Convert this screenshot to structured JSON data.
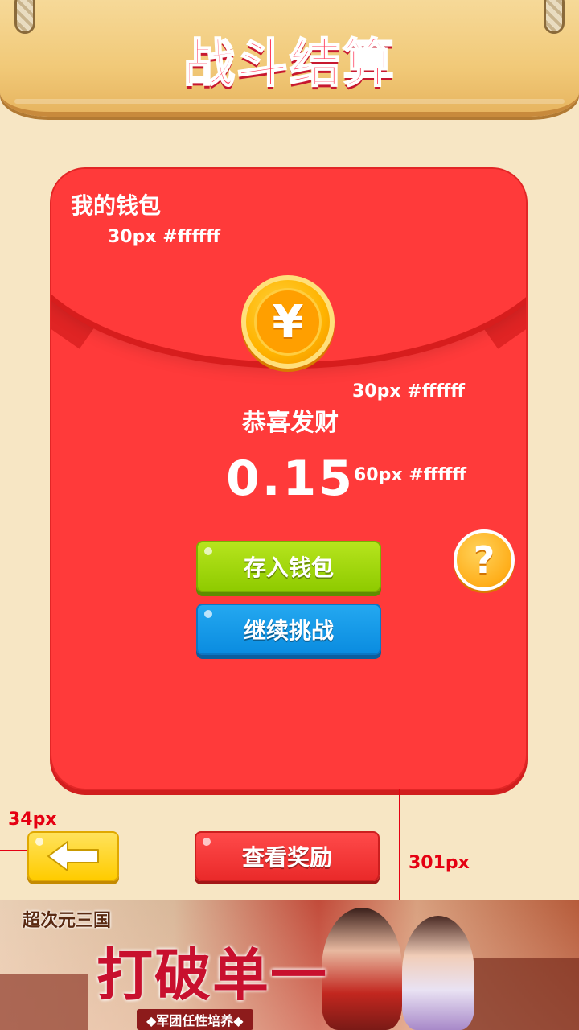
{
  "header": {
    "title": "战斗结算"
  },
  "wallet": {
    "title": "我的钱包",
    "coin_symbol": "¥",
    "congrats": "恭喜发财",
    "amount": "0.15",
    "save_button": "存入钱包",
    "continue_button": "继续挑战",
    "help_symbol": "?"
  },
  "annotations": {
    "title_spec": "30px #ffffff",
    "congrats_spec": "30px #ffffff",
    "amount_spec": "60px #ffffff",
    "left_margin": "34px",
    "center_offset": "301px"
  },
  "footer": {
    "view_reward_button": "查看奖励"
  },
  "banner": {
    "logo": "超次元三国",
    "slogan": "打破单一",
    "subslogan": "◆军团任性培养◆"
  },
  "colors": {
    "background": "#f7e6c4",
    "envelope": "#ff3a3a",
    "green_button": "#8fcb00",
    "blue_button": "#0a8ce0",
    "red_button": "#ea2a2a",
    "yellow_button": "#ffcc00",
    "annotation_red": "#e50012"
  }
}
